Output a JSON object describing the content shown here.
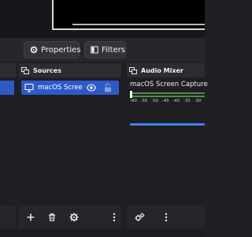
{
  "toolbar": {
    "properties_label": "Properties",
    "filters_label": "Filters"
  },
  "docks": {
    "sources": {
      "title": "Sources",
      "items": [
        {
          "name": "macOS Scree",
          "selected": true
        }
      ]
    },
    "audio_mixer": {
      "title": "Audio Mixer",
      "channel_name": "macOS Screen Capture",
      "meter_ticks": [
        "-60",
        "-55",
        "-50",
        "-45",
        "-40",
        "-35",
        "-30"
      ]
    }
  },
  "icons": {
    "properties": "gear-icon",
    "filters": "filter-icon",
    "dock_title": "dock-undock-icon",
    "source_type": "monitor-icon",
    "visibility": "eye-icon",
    "lock": "lock-icon",
    "add": "plus-icon",
    "remove": "trash-icon",
    "settings": "gear-icon",
    "more": "kebab-menu-icon",
    "mixer_settings": "gears-icon"
  },
  "colors": {
    "selection": "#2e59c9",
    "meter_green": "#4c8f3c",
    "volume_blue": "#3d84e0",
    "panel_bg": "#25252b"
  }
}
